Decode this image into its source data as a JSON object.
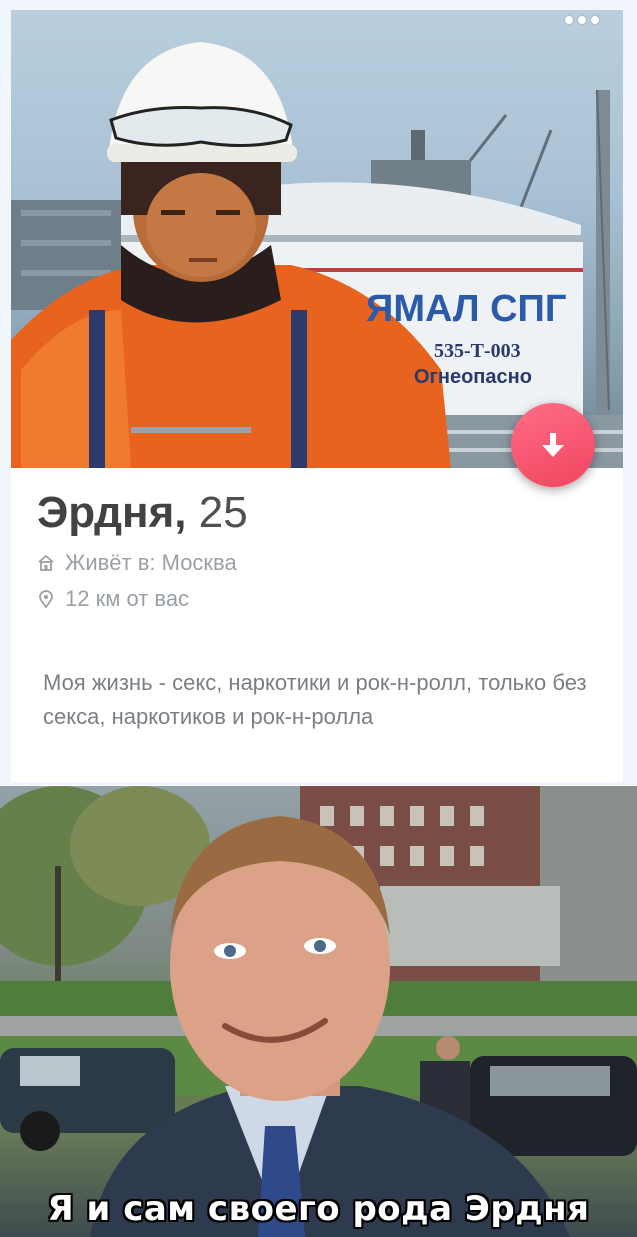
{
  "profile": {
    "name": "Эрдня,",
    "age": "25",
    "lives_in": "Живёт в: Москва",
    "distance": "12 км от вас",
    "bio": "Моя жизнь - секс, наркотики и рок-н-ролл, только без секса, наркотиков и рок-н-ролла"
  },
  "photo_sign": {
    "brand": "ЯМАЛ СПГ",
    "code": "535-Т-003",
    "warning": "Огнеопасно"
  },
  "icons": {
    "more": "more-dots-icon",
    "down": "arrow-down-icon",
    "home": "home-icon",
    "location": "location-pin-icon"
  },
  "colors": {
    "accent": "#f0455f",
    "text_primary": "#424242",
    "text_secondary": "#9aa0a6"
  },
  "meme": {
    "caption": "Я и сам своего рода Эрдня"
  }
}
